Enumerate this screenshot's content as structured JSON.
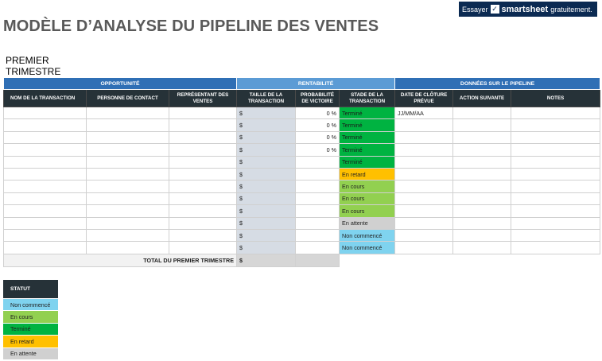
{
  "title": "MODÈLE D’ANALYSE DU PIPELINE DES VENTES",
  "subtitle": "PREMIER TRIMESTRE",
  "banner": {
    "prefix": "Essayer",
    "brand": "smartsheet",
    "suffix": "gratuitement."
  },
  "colors": {
    "group_dark_blue": "#2f6fb5",
    "group_light_blue": "#5b9bd5",
    "header_dark": "#263238",
    "size_column": "#d6dce4",
    "status_done": "#00b341",
    "status_late": "#ffc000",
    "status_in_progress": "#92d050",
    "status_waiting": "#d0d0d0",
    "status_not_started": "#7fd3ef"
  },
  "groups": {
    "opportunity": "OPPORTUNITÉ",
    "profitability": "RENTABILITÉ",
    "pipeline": "DONNÉES SUR LE PIPELINE"
  },
  "columns": {
    "deal_name": "NOM DE LA TRANSACTION",
    "contact": "PERSONNE DE CONTACT",
    "rep": "REPRÉSENTANT DES VENTES",
    "deal_size": "TAILLE DE LA TRANSACTION",
    "win_prob": "PROBABILITÉ DE VICTOIRE",
    "stage": "STADE DE LA TRANSACTION",
    "close_date": "DATE DE CLÔTURE PRÉVUE",
    "next_action": "ACTION SUIVANTE",
    "notes": "NOTES"
  },
  "rows": [
    {
      "size": "$",
      "prob": "0 %",
      "stage": "Terminé",
      "date": "JJ/MM/AA"
    },
    {
      "size": "$",
      "prob": "0 %",
      "stage": "Terminé",
      "date": ""
    },
    {
      "size": "$",
      "prob": "0 %",
      "stage": "Terminé",
      "date": ""
    },
    {
      "size": "$",
      "prob": "0 %",
      "stage": "Terminé",
      "date": ""
    },
    {
      "size": "$",
      "prob": "",
      "stage": "Terminé",
      "date": ""
    },
    {
      "size": "$",
      "prob": "",
      "stage": "En retard",
      "date": ""
    },
    {
      "size": "$",
      "prob": "",
      "stage": "En cours",
      "date": ""
    },
    {
      "size": "$",
      "prob": "",
      "stage": "En cours",
      "date": ""
    },
    {
      "size": "$",
      "prob": "",
      "stage": "En cours",
      "date": ""
    },
    {
      "size": "$",
      "prob": "",
      "stage": "En attente",
      "date": ""
    },
    {
      "size": "$",
      "prob": "",
      "stage": "Non commencé",
      "date": ""
    },
    {
      "size": "$",
      "prob": "",
      "stage": "Non commencé",
      "date": ""
    }
  ],
  "total": {
    "label": "TOTAL DU PREMIER TRIMESTRE",
    "value": "$"
  },
  "legend": {
    "header": "STATUT",
    "items": [
      "Non commencé",
      "En cours",
      "Terminé",
      "En retard",
      "En attente"
    ]
  }
}
